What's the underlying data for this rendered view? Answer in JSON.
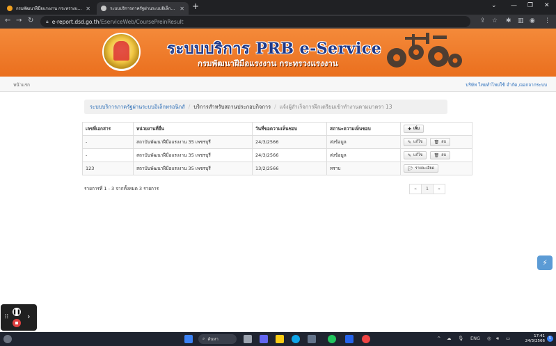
{
  "browser": {
    "tabs": [
      {
        "title": "กรมพัฒนาฝีมือแรงงาน กระทรวงแรงงาน",
        "active": false
      },
      {
        "title": "ระบบบริการภาครัฐผ่านระบบอิเล็กทรอนิ",
        "active": true
      }
    ],
    "url_host": "e-report.dsd.go.th",
    "url_path": "/EserviceWeb/CourseP​reinResult"
  },
  "header": {
    "title": "ระบบบริการ PRB e-Service",
    "subtitle": "กรมพัฒนาฝีมือแรงงาน กระทรวงแรงงาน"
  },
  "nav": {
    "home": "หน้าแรก",
    "user": "บริษัท ไทยทำไทยใช้ จำกัด /ออกจากระบบ"
  },
  "breadcrumb": [
    "ระบบบริการภาครัฐผ่านระบบอิเล็กทรอนิกส์",
    "บริการสำหรับสถานประกอบกิจการ",
    "แจ้งผู้สำเร็จการฝึกเตรียมเข้าทำงานตามมาตรา 13"
  ],
  "table": {
    "headers": [
      "เลขที่เอกสาร",
      "หน่วยงานที่ยื่น",
      "วันที่ขอความเห็นชอบ",
      "สถานะความเห็นชอบ"
    ],
    "add_label": "เพิ่ม",
    "rows": [
      {
        "doc_no": "-",
        "agency": "สถาบันพัฒนาฝีมือแรงงาน 35 เพชรบุรี",
        "date": "24/3/2566",
        "status": "ส่งข้อมูล",
        "actions": [
          "แก้ไข",
          "ลบ"
        ]
      },
      {
        "doc_no": "-",
        "agency": "สถาบันพัฒนาฝีมือแรงงาน 35 เพชรบุรี",
        "date": "24/3/2566",
        "status": "ส่งข้อมูล",
        "actions": [
          "แก้ไข",
          "ลบ"
        ]
      },
      {
        "doc_no": "123",
        "agency": "สถาบันพัฒนาฝีมือแรงงาน 35 เพชรบุรี",
        "date": "13/2/2566",
        "status": "ทราบ",
        "actions": [
          "รายละเอียด"
        ]
      }
    ]
  },
  "summary": "รายการที่ 1 - 3 จากทั้งหมด 3 รายการ",
  "pager": {
    "prev": "«",
    "current": "1",
    "next": "»"
  },
  "taskbar": {
    "search": "ค้นหา",
    "lang": "ENG",
    "time": "17:41",
    "date": "24/3/2566",
    "notif_count": "5"
  }
}
